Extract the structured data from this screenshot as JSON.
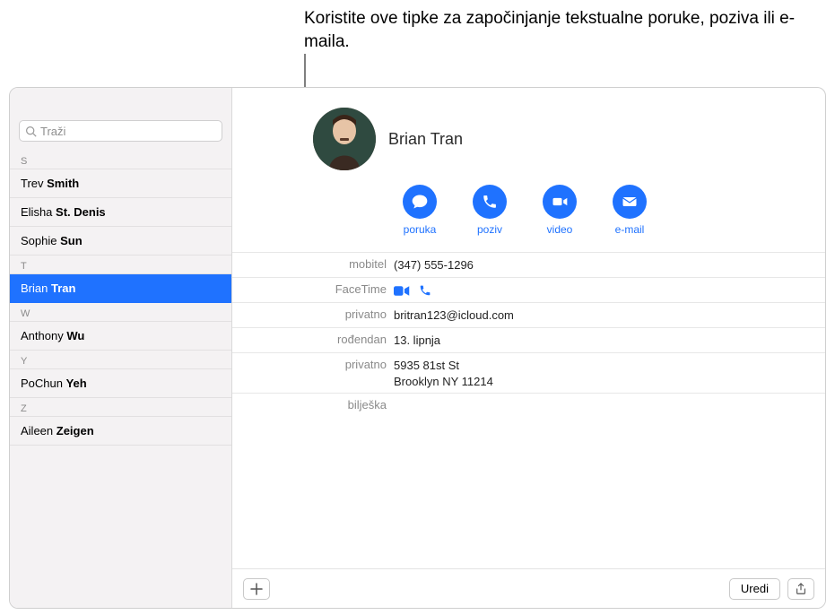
{
  "annotation": "Koristite ove tipke za započinjanje tekstualne poruke, poziva ili e-maila.",
  "search": {
    "placeholder": "Traži"
  },
  "sidebar": {
    "sections": [
      {
        "letter": "S",
        "items": [
          {
            "first": "Trev",
            "last": "Smith"
          },
          {
            "first": "Elisha",
            "last": "St. Denis"
          },
          {
            "first": "Sophie",
            "last": "Sun"
          }
        ]
      },
      {
        "letter": "T",
        "items": [
          {
            "first": "Brian",
            "last": "Tran",
            "selected": true
          }
        ]
      },
      {
        "letter": "W",
        "items": [
          {
            "first": "Anthony",
            "last": "Wu"
          }
        ]
      },
      {
        "letter": "Y",
        "items": [
          {
            "first": "PoChun",
            "last": "Yeh"
          }
        ]
      },
      {
        "letter": "Z",
        "items": [
          {
            "first": "Aileen",
            "last": "Zeigen"
          }
        ]
      }
    ]
  },
  "contact": {
    "name": "Brian Tran",
    "actions": {
      "message": "poruka",
      "call": "poziv",
      "video": "video",
      "email": "e-mail"
    },
    "fields": {
      "mobile_label": "mobitel",
      "mobile_value": "(347) 555-1296",
      "facetime_label": "FaceTime",
      "email_label": "privatno",
      "email_value": "britran123@icloud.com",
      "birthday_label": "rođendan",
      "birthday_value": "13. lipnja",
      "address_label": "privatno",
      "address_value": "5935 81st St\nBrooklyn NY 11214",
      "note_label": "bilješka"
    }
  },
  "buttons": {
    "edit": "Uredi"
  }
}
